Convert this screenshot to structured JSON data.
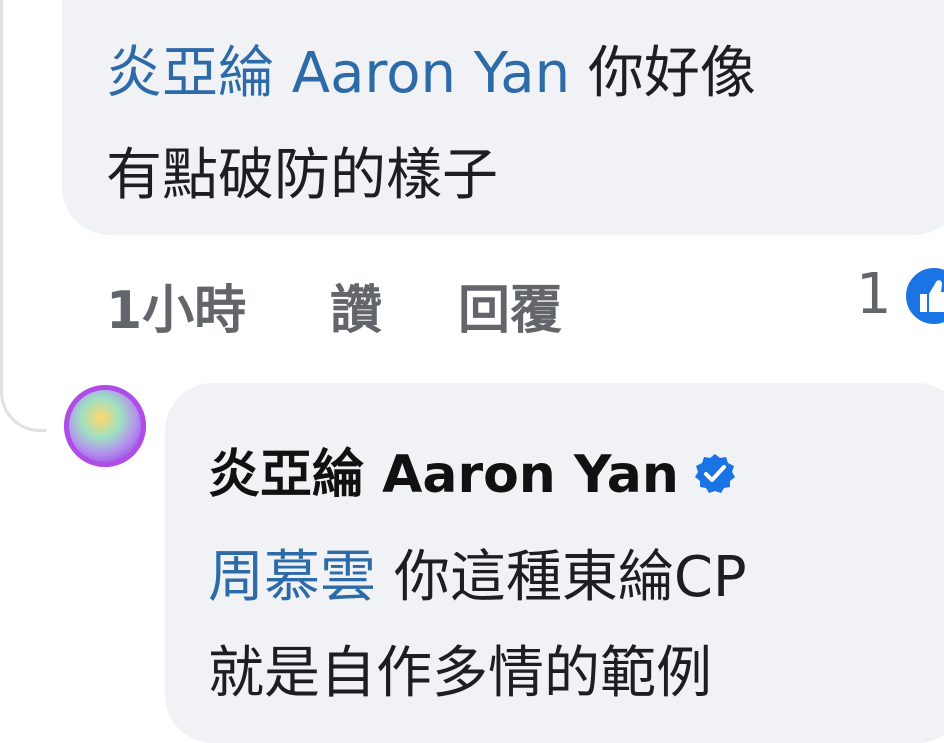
{
  "comment1": {
    "mention": "炎亞綸 Aaron Yan",
    "text_line1": "你好像",
    "text_line2": "有點破防的樣子",
    "time": "1小時",
    "like_label": "讚",
    "reply_label": "回覆",
    "reaction_count": "1",
    "reaction_icon": "thumbs-up-icon"
  },
  "reply": {
    "author": "炎亞綸 Aaron Yan",
    "verified_icon": "verified-badge-icon",
    "mention": "周慕雲",
    "text_line1": "你這種東綸CP",
    "text_line2": "就是自作多情的範例"
  },
  "colors": {
    "mention": "#2d6aa8",
    "bubble": "#f0f2f5",
    "meta": "#62666b",
    "accent": "#1b74e4"
  }
}
